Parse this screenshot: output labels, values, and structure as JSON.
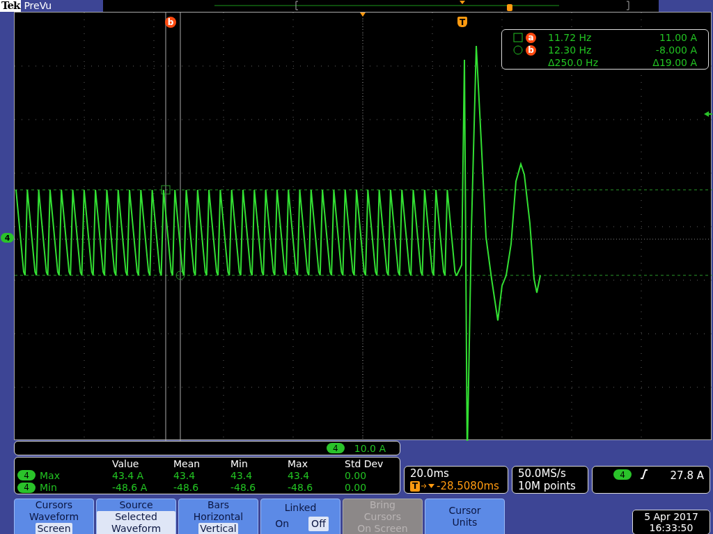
{
  "topbar": {
    "brand": "Tek",
    "mode": "PreVu"
  },
  "graticule": {
    "cursor_label": "b",
    "trigger_marker": "T",
    "channel_marker": "4"
  },
  "cursor_readout": {
    "rows": [
      {
        "kind": "square",
        "cursor": "a",
        "frequency": "11.72 Hz",
        "value": "11.00 A"
      },
      {
        "kind": "circle",
        "cursor": "b",
        "frequency": "12.30 Hz",
        "value": "-8.000 A"
      }
    ],
    "delta": {
      "frequency": "Δ250.0 Hz",
      "value": "Δ19.00 A"
    }
  },
  "channel_scale": {
    "channel": "4",
    "scale": "10.0 A"
  },
  "measurements": {
    "columns": [
      "Value",
      "Mean",
      "Min",
      "Max",
      "Std Dev"
    ],
    "rows": [
      {
        "channel": "4",
        "name": "Max",
        "cells": [
          "43.4 A",
          "43.4",
          "43.4",
          "43.4",
          "0.00"
        ]
      },
      {
        "channel": "4",
        "name": "Min",
        "cells": [
          "-48.6 A",
          "-48.6",
          "-48.6",
          "-48.6",
          "0.00"
        ]
      }
    ]
  },
  "horizontal": {
    "scale": "20.0ms",
    "trigger_marker": "T",
    "position": "-28.5080ms"
  },
  "acquisition": {
    "sample_rate": "50.0MS/s",
    "record_length": "10M points"
  },
  "trigger": {
    "channel": "4",
    "level": "27.8 A"
  },
  "menu_buttons": [
    {
      "kind": "options",
      "title": "Cursors",
      "options": [
        {
          "label": "Waveform",
          "selected": false
        },
        {
          "label": "Screen",
          "selected": true
        }
      ]
    },
    {
      "kind": "options",
      "title": "Source",
      "options": [
        {
          "label": "Selected Waveform",
          "selected": true
        }
      ]
    },
    {
      "kind": "options",
      "title": "Bars",
      "options": [
        {
          "label": "Horizontal",
          "selected": false
        },
        {
          "label": "Vertical",
          "selected": true
        }
      ]
    },
    {
      "kind": "toggle",
      "title": "Linked",
      "options": [
        {
          "label": "On",
          "selected": false
        },
        {
          "label": "Off",
          "selected": true
        }
      ]
    },
    {
      "kind": "action",
      "label": "Bring Cursors On Screen",
      "disabled": true
    },
    {
      "kind": "action",
      "label": "Cursor Units",
      "disabled": false
    }
  ],
  "datetime": {
    "date": "5 Apr 2017",
    "time": "16:33:50"
  }
}
